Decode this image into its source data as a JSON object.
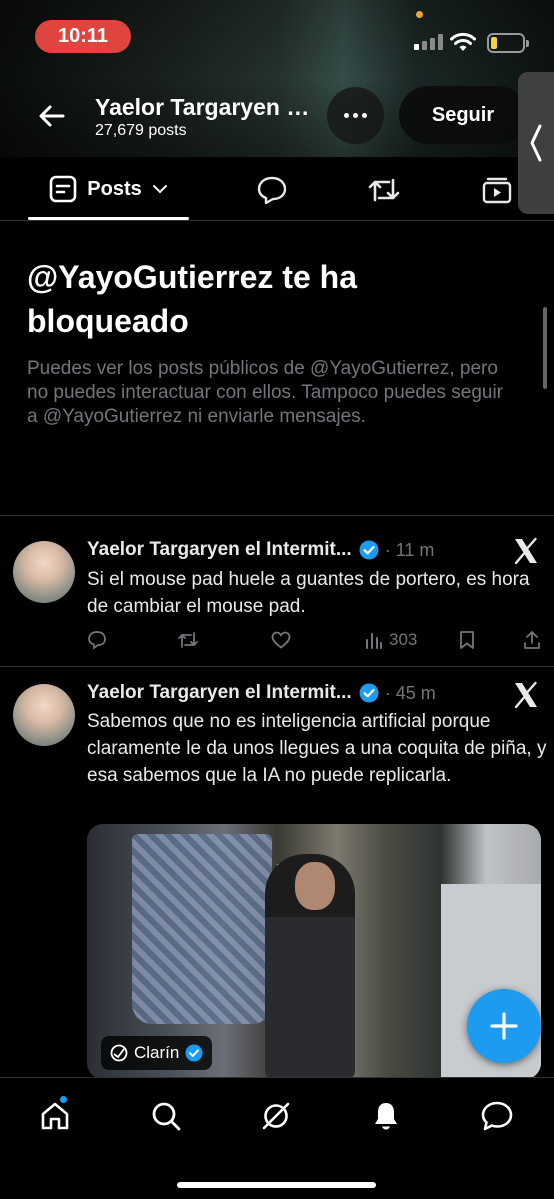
{
  "status_bar": {
    "time": "10:11",
    "battery_color": "#f4d03f",
    "time_pill_color": "#e0443e"
  },
  "header": {
    "name": "Yaelor Targaryen el Intermitente",
    "posts_count": "27,679 posts",
    "follow_label": "Seguir",
    "back_icon": "arrow-left-icon",
    "more_icon": "more-horizontal-icon"
  },
  "tabs": {
    "active_label": "Posts",
    "items": [
      "posts",
      "replies",
      "reposts",
      "videos"
    ]
  },
  "blocked_notice": {
    "title": "@YayoGutierrez te ha bloqueado",
    "description": "Puedes ver los posts públicos de @YayoGutierrez, pero no puedes interactuar con ellos. Tampoco puedes seguir a @YayoGutierrez ni enviarle mensajes."
  },
  "tweets": [
    {
      "author": "Yaelor Targaryen el Intermit...",
      "time": "· 11 m",
      "text": "Si el mouse pad huele a guantes de portero, es hora de cambiar el mouse pad.",
      "views": "303"
    },
    {
      "author": "Yaelor Targaryen el Intermit...",
      "time": "· 45 m",
      "text": "Sabemos que no es inteligencia artificial porque claramente le da unos llegues a una coquita de piña, y esa sabemos que la IA no puede replicarla.",
      "media_source": "Clarín"
    }
  ],
  "accent_color": "#1d9bf0",
  "bottom_nav": [
    "home-icon",
    "search-icon",
    "grok-icon",
    "notifications-icon",
    "messages-icon"
  ]
}
